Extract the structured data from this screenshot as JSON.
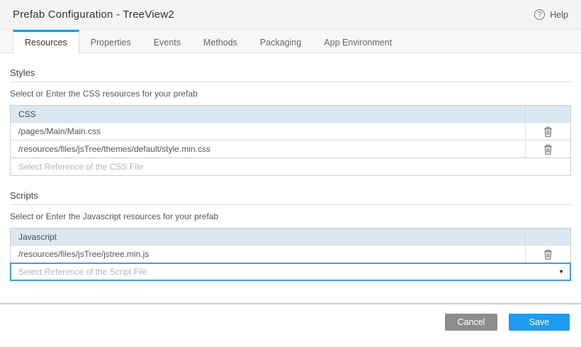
{
  "header": {
    "title": "Prefab Configuration - TreeView2",
    "help_label": "Help",
    "help_icon_glyph": "?"
  },
  "tabs": [
    {
      "label": "Resources",
      "active": true
    },
    {
      "label": "Properties",
      "active": false
    },
    {
      "label": "Events",
      "active": false
    },
    {
      "label": "Methods",
      "active": false
    },
    {
      "label": "Packaging",
      "active": false
    },
    {
      "label": "App Environment",
      "active": false
    }
  ],
  "styles_section": {
    "heading": "Styles",
    "subtitle": "Select or Enter the CSS resources for your prefab",
    "table": {
      "header": "CSS",
      "rows": [
        "/pages/Main/Main.css",
        "/resources/files/jsTree/themes/default/style.min.css"
      ],
      "placeholder": "Select Reference of the CSS File"
    }
  },
  "scripts_section": {
    "heading": "Scripts",
    "subtitle": "Select or Enter the Javascript resources for your prefab",
    "table": {
      "header": "Javascript",
      "rows": [
        "/resources/files/jsTree/jstree.min.js"
      ],
      "placeholder": "Select Reference of the Script File"
    }
  },
  "footer": {
    "cancel_label": "Cancel",
    "save_label": "Save"
  },
  "colors": {
    "accent_blue": "#1e9bf0",
    "focus_border_blue": "#3da0e3",
    "table_header_bg": "#dbe8f4",
    "cancel_gray": "#8d8d8d",
    "header_bg": "#f4f4f4"
  },
  "icons": {
    "delete": "trash-icon",
    "help": "question-circle-icon",
    "dropdown": "caret-down-icon",
    "dropdown_glyph": "▼"
  }
}
